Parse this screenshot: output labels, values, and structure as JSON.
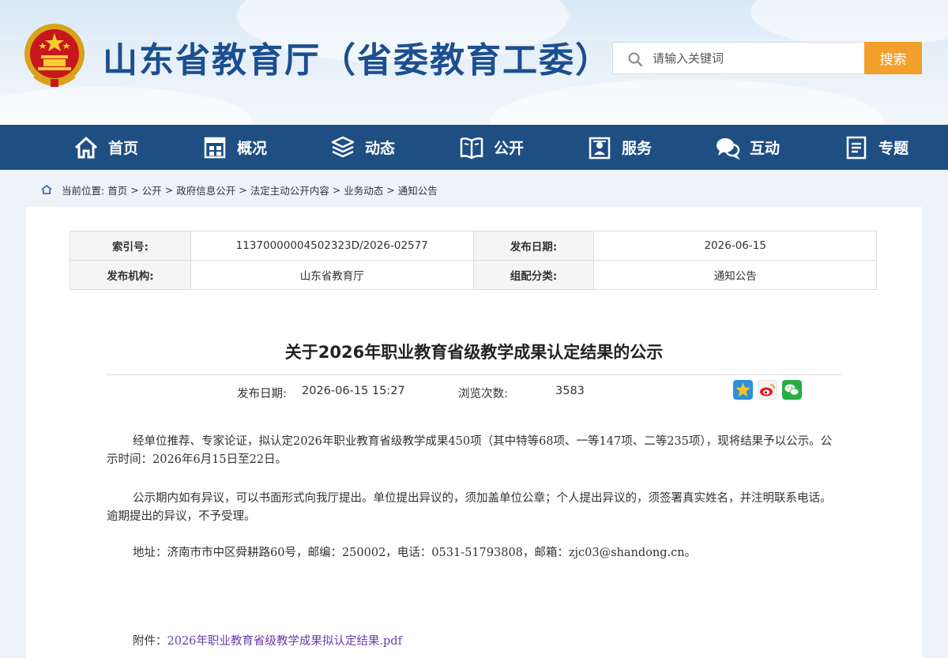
{
  "header": {
    "site_title": "山东省教育厅（省委教育工委）",
    "search": {
      "placeholder": "请输入关键词",
      "button": "搜索"
    }
  },
  "nav": {
    "items": [
      {
        "label": "首页",
        "icon": "home-icon"
      },
      {
        "label": "概况",
        "icon": "building-icon"
      },
      {
        "label": "动态",
        "icon": "news-stack-icon"
      },
      {
        "label": "公开",
        "icon": "book-icon"
      },
      {
        "label": "服务",
        "icon": "service-icon"
      },
      {
        "label": "互动",
        "icon": "chat-bubbles-icon"
      },
      {
        "label": "专题",
        "icon": "document-icon"
      }
    ]
  },
  "breadcrumb": {
    "prefix": "当前位置:",
    "items": [
      "首页",
      "公开",
      "政府信息公开",
      "法定主动公开内容",
      "业务动态",
      "通知公告"
    ],
    "separator": ">"
  },
  "meta": {
    "index_label": "索引号:",
    "index_value": "11370000004502323D/2026-02577",
    "date_label": "发布日期:",
    "date_value": "2026-06-15",
    "org_label": "发布机构:",
    "org_value": "山东省教育厅",
    "category_label": "组配分类:",
    "category_value": "通知公告"
  },
  "article": {
    "title": "关于2026年职业教育省级教学成果认定结果的公示",
    "date_label": "发布日期:",
    "date_value": "2026-06-15 15:27",
    "views_label": "浏览次数:",
    "views_value": "3583",
    "share_icons": [
      "qzone-star-icon",
      "weibo-icon",
      "wechat-icon"
    ],
    "paragraphs": [
      "经单位推荐、专家论证，拟认定2026年职业教育省级教学成果450项（其中特等68项、一等147项、二等235项），现将结果予以公示。公示时间：2026年6月15日至22日。",
      "公示期内如有异议，可以书面形式向我厅提出。单位提出异议的，须加盖单位公章；个人提出异议的，须签署真实姓名，并注明联系电话。逾期提出的异议，不予受理。",
      "地址：济南市市中区舜耕路60号，邮编：250002，电话：0531-51793808，邮箱：zjc03@shandong.cn。"
    ],
    "attachment_label": "附件：",
    "attachment_file": "2026年职业教育省级教学成果拟认定结果.pdf"
  },
  "colors": {
    "nav_bg": "#1f4e82",
    "title_blue": "#1c4f8f",
    "search_button": "#f2a02b",
    "link_purple": "#6c3aa8"
  }
}
